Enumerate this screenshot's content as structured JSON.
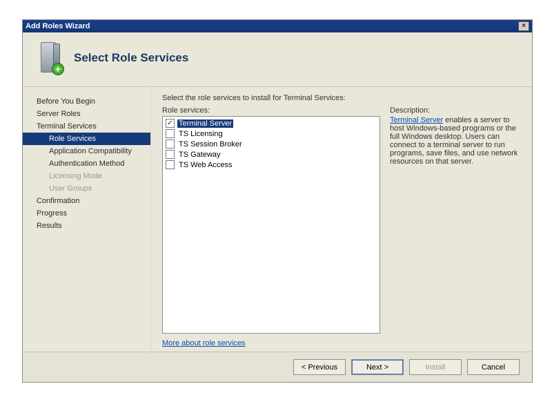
{
  "window": {
    "title": "Add Roles Wizard"
  },
  "header": {
    "page_title": "Select Role Services"
  },
  "nav": {
    "items": [
      {
        "label": "Before You Begin",
        "sub": false,
        "selected": false,
        "disabled": false
      },
      {
        "label": "Server Roles",
        "sub": false,
        "selected": false,
        "disabled": false
      },
      {
        "label": "Terminal Services",
        "sub": false,
        "selected": false,
        "disabled": false
      },
      {
        "label": "Role Services",
        "sub": true,
        "selected": true,
        "disabled": false
      },
      {
        "label": "Application Compatibility",
        "sub": true,
        "selected": false,
        "disabled": false
      },
      {
        "label": "Authentication Method",
        "sub": true,
        "selected": false,
        "disabled": false
      },
      {
        "label": "Licensing Mode",
        "sub": true,
        "selected": false,
        "disabled": true
      },
      {
        "label": "User Groups",
        "sub": true,
        "selected": false,
        "disabled": true
      },
      {
        "label": "Confirmation",
        "sub": false,
        "selected": false,
        "disabled": false
      },
      {
        "label": "Progress",
        "sub": false,
        "selected": false,
        "disabled": false
      },
      {
        "label": "Results",
        "sub": false,
        "selected": false,
        "disabled": false
      }
    ]
  },
  "content": {
    "prompt": "Select the role services to install for Terminal Services:",
    "list_label": "Role services:",
    "roles": [
      {
        "label": "Terminal Server",
        "checked": true,
        "highlight": true
      },
      {
        "label": "TS Licensing",
        "checked": false,
        "highlight": false
      },
      {
        "label": "TS Session Broker",
        "checked": false,
        "highlight": false
      },
      {
        "label": "TS Gateway",
        "checked": false,
        "highlight": false
      },
      {
        "label": "TS Web Access",
        "checked": false,
        "highlight": false
      }
    ],
    "desc_label": "Description:",
    "desc_link_text": "Terminal Server",
    "desc_rest": " enables a server to host Windows-based programs or the full Windows desktop. Users can connect to a terminal server to run programs, save files, and use network resources on that server.",
    "more_link": "More about role services"
  },
  "footer": {
    "previous": "< Previous",
    "next": "Next >",
    "install": "Install",
    "cancel": "Cancel"
  }
}
